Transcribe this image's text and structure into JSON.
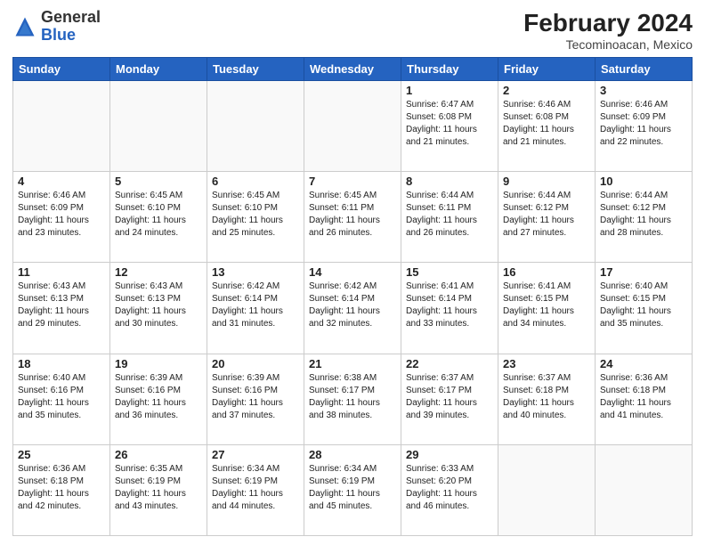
{
  "header": {
    "logo_general": "General",
    "logo_blue": "Blue",
    "title": "February 2024",
    "location": "Tecominoacan, Mexico"
  },
  "days_of_week": [
    "Sunday",
    "Monday",
    "Tuesday",
    "Wednesday",
    "Thursday",
    "Friday",
    "Saturday"
  ],
  "weeks": [
    [
      {
        "day": "",
        "info": ""
      },
      {
        "day": "",
        "info": ""
      },
      {
        "day": "",
        "info": ""
      },
      {
        "day": "",
        "info": ""
      },
      {
        "day": "1",
        "info": "Sunrise: 6:47 AM\nSunset: 6:08 PM\nDaylight: 11 hours and 21 minutes."
      },
      {
        "day": "2",
        "info": "Sunrise: 6:46 AM\nSunset: 6:08 PM\nDaylight: 11 hours and 21 minutes."
      },
      {
        "day": "3",
        "info": "Sunrise: 6:46 AM\nSunset: 6:09 PM\nDaylight: 11 hours and 22 minutes."
      }
    ],
    [
      {
        "day": "4",
        "info": "Sunrise: 6:46 AM\nSunset: 6:09 PM\nDaylight: 11 hours and 23 minutes."
      },
      {
        "day": "5",
        "info": "Sunrise: 6:45 AM\nSunset: 6:10 PM\nDaylight: 11 hours and 24 minutes."
      },
      {
        "day": "6",
        "info": "Sunrise: 6:45 AM\nSunset: 6:10 PM\nDaylight: 11 hours and 25 minutes."
      },
      {
        "day": "7",
        "info": "Sunrise: 6:45 AM\nSunset: 6:11 PM\nDaylight: 11 hours and 26 minutes."
      },
      {
        "day": "8",
        "info": "Sunrise: 6:44 AM\nSunset: 6:11 PM\nDaylight: 11 hours and 26 minutes."
      },
      {
        "day": "9",
        "info": "Sunrise: 6:44 AM\nSunset: 6:12 PM\nDaylight: 11 hours and 27 minutes."
      },
      {
        "day": "10",
        "info": "Sunrise: 6:44 AM\nSunset: 6:12 PM\nDaylight: 11 hours and 28 minutes."
      }
    ],
    [
      {
        "day": "11",
        "info": "Sunrise: 6:43 AM\nSunset: 6:13 PM\nDaylight: 11 hours and 29 minutes."
      },
      {
        "day": "12",
        "info": "Sunrise: 6:43 AM\nSunset: 6:13 PM\nDaylight: 11 hours and 30 minutes."
      },
      {
        "day": "13",
        "info": "Sunrise: 6:42 AM\nSunset: 6:14 PM\nDaylight: 11 hours and 31 minutes."
      },
      {
        "day": "14",
        "info": "Sunrise: 6:42 AM\nSunset: 6:14 PM\nDaylight: 11 hours and 32 minutes."
      },
      {
        "day": "15",
        "info": "Sunrise: 6:41 AM\nSunset: 6:14 PM\nDaylight: 11 hours and 33 minutes."
      },
      {
        "day": "16",
        "info": "Sunrise: 6:41 AM\nSunset: 6:15 PM\nDaylight: 11 hours and 34 minutes."
      },
      {
        "day": "17",
        "info": "Sunrise: 6:40 AM\nSunset: 6:15 PM\nDaylight: 11 hours and 35 minutes."
      }
    ],
    [
      {
        "day": "18",
        "info": "Sunrise: 6:40 AM\nSunset: 6:16 PM\nDaylight: 11 hours and 35 minutes."
      },
      {
        "day": "19",
        "info": "Sunrise: 6:39 AM\nSunset: 6:16 PM\nDaylight: 11 hours and 36 minutes."
      },
      {
        "day": "20",
        "info": "Sunrise: 6:39 AM\nSunset: 6:16 PM\nDaylight: 11 hours and 37 minutes."
      },
      {
        "day": "21",
        "info": "Sunrise: 6:38 AM\nSunset: 6:17 PM\nDaylight: 11 hours and 38 minutes."
      },
      {
        "day": "22",
        "info": "Sunrise: 6:37 AM\nSunset: 6:17 PM\nDaylight: 11 hours and 39 minutes."
      },
      {
        "day": "23",
        "info": "Sunrise: 6:37 AM\nSunset: 6:18 PM\nDaylight: 11 hours and 40 minutes."
      },
      {
        "day": "24",
        "info": "Sunrise: 6:36 AM\nSunset: 6:18 PM\nDaylight: 11 hours and 41 minutes."
      }
    ],
    [
      {
        "day": "25",
        "info": "Sunrise: 6:36 AM\nSunset: 6:18 PM\nDaylight: 11 hours and 42 minutes."
      },
      {
        "day": "26",
        "info": "Sunrise: 6:35 AM\nSunset: 6:19 PM\nDaylight: 11 hours and 43 minutes."
      },
      {
        "day": "27",
        "info": "Sunrise: 6:34 AM\nSunset: 6:19 PM\nDaylight: 11 hours and 44 minutes."
      },
      {
        "day": "28",
        "info": "Sunrise: 6:34 AM\nSunset: 6:19 PM\nDaylight: 11 hours and 45 minutes."
      },
      {
        "day": "29",
        "info": "Sunrise: 6:33 AM\nSunset: 6:20 PM\nDaylight: 11 hours and 46 minutes."
      },
      {
        "day": "",
        "info": ""
      },
      {
        "day": "",
        "info": ""
      }
    ]
  ]
}
